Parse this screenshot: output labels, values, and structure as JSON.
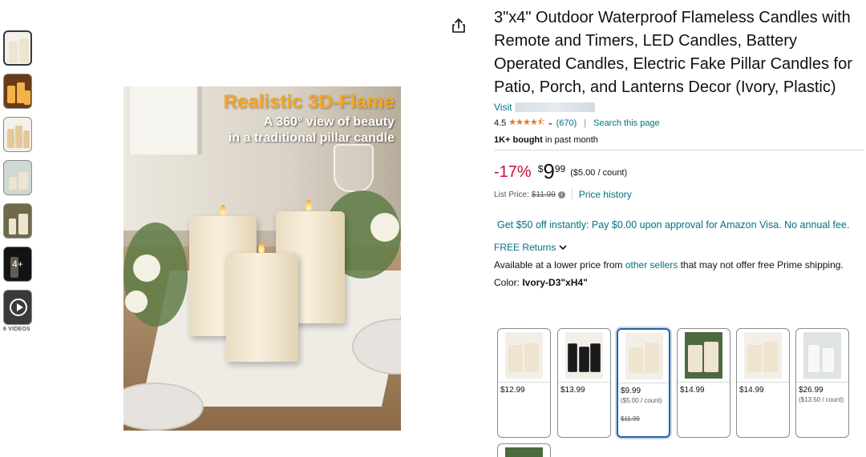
{
  "gallery": {
    "thumbnails": [
      {
        "name": "thumb-1",
        "active": true
      },
      {
        "name": "thumb-2"
      },
      {
        "name": "thumb-3"
      },
      {
        "name": "thumb-4"
      },
      {
        "name": "thumb-5"
      },
      {
        "name": "thumb-6",
        "more_label": "4+"
      },
      {
        "name": "thumb-video",
        "icon": "play-icon"
      }
    ],
    "videos_label": "6 VIDEOS",
    "main_image": {
      "headline": "Realistic 3D-Flame",
      "sub_line_1": "A 360° view of beauty",
      "sub_line_2": "in a traditional pillar candle"
    }
  },
  "share_icon": "share-icon",
  "product": {
    "title": "3\"x4\" Outdoor Waterproof Flameless Candles with Remote and Timers, LED Candles, Battery Operated Candles, Electric Fake Pillar Candles for Patio, Porch, and Lanterns Decor (Ivory, Plastic)",
    "visit_label": "Visit",
    "rating": "4.5",
    "stars": "★★★★⯪",
    "review_count": "(670)",
    "search_page": "Search this page",
    "bought_bold": "1K+ bought",
    "bought_rest": " in past month"
  },
  "pricing": {
    "discount": "-17%",
    "currency": "$",
    "whole": "9",
    "fraction": "99",
    "per_count": "($5.00 / count)",
    "list_price_label": "List Price:",
    "list_price": "$11.99",
    "price_history": "Price history",
    "promo": "Get $50 off instantly: Pay $0.00 upon approval for Amazon Visa. No annual fee.",
    "returns": "FREE Returns",
    "availability_text": "Available at a lower price from ",
    "availability_link": "other sellers",
    "availability_rest": " that may not offer free Prime shipping."
  },
  "color": {
    "label": "Color: ",
    "selected": "Ivory-D3\"xH4\"",
    "swatches": [
      {
        "price": "$12.99"
      },
      {
        "price": "$13.99"
      },
      {
        "price": "$9.99",
        "unit": "($5.00 / count)",
        "list": "$11.99",
        "selected": true
      },
      {
        "price": "$14.99"
      },
      {
        "price": "$14.99"
      },
      {
        "price": "$26.99",
        "unit": "($13.50 / count)"
      }
    ]
  },
  "colors": {
    "accent_link": "#007185",
    "discount_red": "#cc0c39",
    "star_orange": "#de7921",
    "selected_border": "#2162a1"
  }
}
